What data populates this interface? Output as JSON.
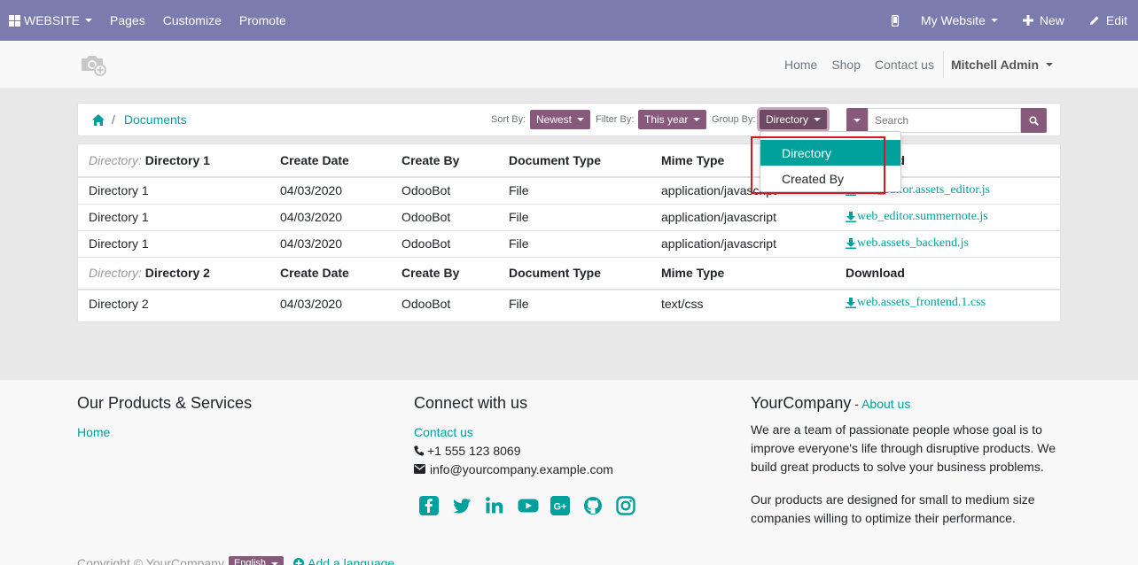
{
  "topbar": {
    "brand": "WEBSITE",
    "menu": [
      "Pages",
      "Customize",
      "Promote"
    ],
    "my_website": "My Website",
    "new": "New",
    "edit": "Edit",
    "bg_color": "#7c7bad"
  },
  "header": {
    "nav": [
      "Home",
      "Shop",
      "Contact us"
    ],
    "user": "Mitchell Admin"
  },
  "controls": {
    "breadcrumb_current": "Documents",
    "sort_label": "Sort By:",
    "sort_value": "Newest",
    "filter_label": "Filter By:",
    "filter_value": "This year",
    "group_label": "Group By:",
    "group_value": "Directory",
    "search_placeholder": "Search",
    "accent": "#875a7b"
  },
  "group_menu": {
    "items": [
      "Directory",
      "Created By"
    ],
    "selected": "Directory",
    "selected_color": "#00a09d"
  },
  "table": {
    "group_prefix": "Directory:",
    "columns": [
      "Create Date",
      "Create By",
      "Document Type",
      "Mime Type",
      "Download"
    ],
    "groups": [
      {
        "name": "Directory 1",
        "rows": [
          {
            "directory": "Directory 1",
            "date": "04/03/2020",
            "by": "OdooBot",
            "type": "File",
            "mime": "application/javascript",
            "download": "web_editor.assets_editor.js"
          },
          {
            "directory": "Directory 1",
            "date": "04/03/2020",
            "by": "OdooBot",
            "type": "File",
            "mime": "application/javascript",
            "download": "web_editor.summernote.js"
          },
          {
            "directory": "Directory 1",
            "date": "04/03/2020",
            "by": "OdooBot",
            "type": "File",
            "mime": "application/javascript",
            "download": "web.assets_backend.js"
          }
        ]
      },
      {
        "name": "Directory 2",
        "rows": [
          {
            "directory": "Directory 2",
            "date": "04/03/2020",
            "by": "OdooBot",
            "type": "File",
            "mime": "text/css",
            "download": "web.assets_frontend.1.css"
          }
        ]
      }
    ]
  },
  "footer": {
    "col1_title": "Our Products & Services",
    "col1_link": "Home",
    "col2_title": "Connect with us",
    "col2_contact": "Contact us",
    "phone": "+1 555 123 8069",
    "email": "info@yourcompany.example.com",
    "social_icons": [
      "facebook-icon",
      "twitter-icon",
      "linkedin-icon",
      "youtube-icon",
      "google-plus-icon",
      "github-icon",
      "instagram-icon"
    ],
    "col3_title": "YourCompany",
    "col3_title_sep": " - ",
    "col3_link": "About us",
    "col3_p1": "We are a team of passionate people whose goal is to improve everyone's life through disruptive products. We build great products to solve your business problems.",
    "col3_p2": "Our products are designed for small to medium size companies willing to optimize their performance.",
    "copyright": "Copyright © YourCompany",
    "language": "English",
    "add_language": "Add a language"
  }
}
